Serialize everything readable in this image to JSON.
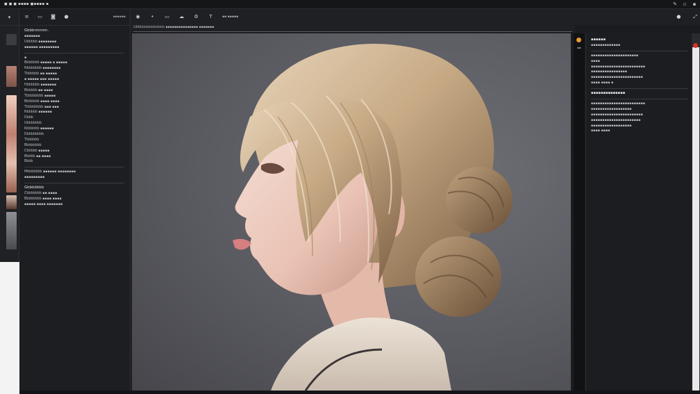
{
  "window": {
    "title": "◼ ◼ ◼ ▪▪▪▪ ◼▪▪▪▪ ▪",
    "controls": [
      "minimize-icon",
      "close-icon"
    ]
  },
  "left_toolbar": {
    "label": "▪▪▪▪▪▪"
  },
  "left_panel": {
    "lines": [
      {
        "text": "Gbbbnnnnm.",
        "head": true
      },
      {
        "text": "▪▪▪▪▪▪▪"
      },
      {
        "text": "Ubbbbb ▪▪▪▪▪▪▪▪"
      },
      {
        "text": "▪▪▪▪▪▪ ▪▪▪▪▪▪▪▪▪"
      },
      {
        "sep": true
      },
      {
        "text": "▪"
      },
      {
        "text": "Bbbbbbb ▪▪▪▪▪ ▪ ▪▪▪▪▪"
      },
      {
        "text": "Nbbbbbbb ▪▪▪▪▪▪▪▪"
      },
      {
        "text": "Tbbbbbb ▪▪ ▪▪▪▪▪"
      },
      {
        "text": "▪ ▪▪▪▪▪ ▪▪▪ ▪▪▪▪▪"
      },
      {
        "text": "Hbbbbbb ▪▪▪▪▪▪▪"
      },
      {
        "text": "Bbbbbb ▪▪ ▪▪▪▪"
      },
      {
        "text": "Tbbbbbbbb ▪▪▪▪▪"
      },
      {
        "text": "Bbbbbbb ▪▪▪▪ ▪▪▪▪"
      },
      {
        "text": "Tbbbbbbbb ▪▪▪ ▪▪▪"
      },
      {
        "text": "Nbbbbb ▪▪▪▪▪▪"
      },
      {
        "text": "Dbbb"
      },
      {
        "text": "Ubbbbbbb"
      },
      {
        "text": "Kbbbbbb ▪▪▪▪▪▪"
      },
      {
        "text": "Dbbbbbbbb"
      },
      {
        "text": "Tbbbbbb"
      },
      {
        "text": "Bbbbbbbb"
      },
      {
        "text": "Cbbbbb ▪▪▪▪▪"
      },
      {
        "text": "Bbbbb ▪▪ ▪▪▪▪"
      },
      {
        "text": "Bbbb"
      },
      {
        "sep": true
      },
      {
        "text": "Mbbbbbbb ▪▪▪▪▪▪ ▪▪▪▪▪▪▪▪"
      },
      {
        "text": "▪▪▪▪▪▪▪▪▪"
      },
      {
        "sep": true
      },
      {
        "text": "Gbbbbbbb",
        "head": true
      },
      {
        "text": "Cbbbbbbb ▪▪ ▪▪▪▪"
      },
      {
        "text": "Bbbbbbbb ▪▪▪▪ ▪▪▪▪"
      },
      {
        "text": "▪▪▪▪▪ ▪▪▪▪ ▪▪▪▪▪▪▪"
      }
    ]
  },
  "canvas_toolbar": {
    "label": "▪▪ ▪▪▪▪▪"
  },
  "document_tab": {
    "label": "GBBbbbbbbbbbbbb ▪▪▪▪▪▪▪▪▪▪▪▪▪▪▪ ▪▪▪▪▪▪▪"
  },
  "right_strip": {
    "label": "▪▪"
  },
  "right_panel": {
    "lines": [
      {
        "text": "▪▪▪▪▪▪",
        "head": true
      },
      {
        "text": "▪▪▪▪▪▪▪▪▪▪▪▪▪"
      },
      {
        "sep": true
      },
      {
        "text": "▪▪▪▪▪▪▪▪▪▪▪▪▪▪▪▪▪▪▪▪▪"
      },
      {
        "text": "▪▪▪▪"
      },
      {
        "text": "▪▪▪▪▪▪▪▪▪▪▪▪▪▪▪▪▪▪▪▪▪▪▪▪"
      },
      {
        "text": "▪▪▪▪▪▪▪▪▪▪▪▪▪▪▪▪"
      },
      {
        "text": "▪▪▪▪▪▪▪▪▪▪▪▪▪▪▪▪▪▪▪▪▪▪▪"
      },
      {
        "text": "▪▪▪▪ ▪▪▪▪ ▪"
      },
      {
        "sep": true
      },
      {
        "text": "▪▪▪▪▪▪▪▪▪▪▪▪▪▪",
        "head": true
      },
      {
        "sep": true
      },
      {
        "text": "▪▪▪▪▪▪▪▪▪▪▪▪▪▪▪▪▪▪▪▪▪▪▪▪"
      },
      {
        "text": "▪▪▪▪▪▪▪▪▪▪▪▪▪▪▪▪▪▪"
      },
      {
        "text": "▪▪▪▪▪▪▪▪▪▪▪▪▪▪▪▪▪▪▪▪▪▪▪"
      },
      {
        "text": "▪▪▪▪▪▪▪▪▪▪▪▪▪▪▪▪▪▪▪▪▪▪"
      },
      {
        "text": "▪▪▪▪▪▪▪▪▪▪▪▪▪▪▪▪▪▪"
      },
      {
        "text": "▪▪▪▪ ▪▪▪▪"
      }
    ]
  },
  "colors": {
    "accent": "#e89a2c",
    "alert": "#d9302a",
    "canvas_bg": "#5d5d64"
  },
  "canvas_image": {
    "subject": "portrait-of-girl-with-blonde-hair-bun"
  }
}
